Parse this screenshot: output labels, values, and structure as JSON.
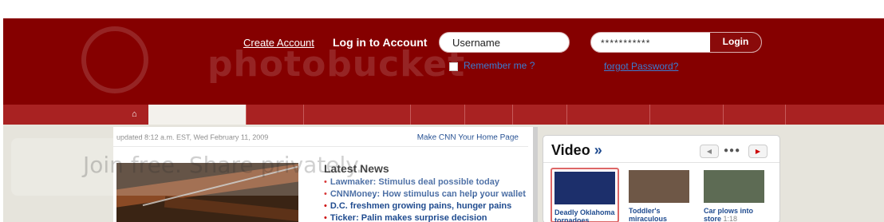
{
  "header": {
    "create_account": "Create Account",
    "login_label": "Log in to Account",
    "username_value": "Username",
    "password_value": "***********",
    "login_button": "Login",
    "remember_me": "Remember me ?",
    "forgot_password": "forgot Password?"
  },
  "watermark": {
    "top": "photobucket",
    "bottom": "Join free. Share privately."
  },
  "main": {
    "updated": "updated 8:12 a.m. EST, Wed February 11, 2009",
    "make_home": "Make CNN Your Home Page",
    "latest_title": "Latest News",
    "news": [
      "Lawmaker: Stimulus deal possible today",
      "CNNMoney: How stimulus can help your wallet",
      "D.C. freshmen growing pains, hunger pains",
      "Ticker: Palin makes surprise decision"
    ]
  },
  "video": {
    "title": "Video",
    "arrow": "»",
    "prev": "◀",
    "next": "▶",
    "dots": "●●●",
    "items": [
      {
        "caption": "Deadly Oklahoma",
        "caption2": "tornadoes",
        "duration": ""
      },
      {
        "caption": "Toddler's",
        "caption2": "miraculous",
        "duration": ""
      },
      {
        "caption": "Car plows into",
        "caption2": "store",
        "duration": "1:18"
      }
    ]
  },
  "colors": {
    "header": "#850000",
    "nav": "#a92222",
    "link": "#3b7bd0",
    "news_link": "#1f4b8f"
  }
}
